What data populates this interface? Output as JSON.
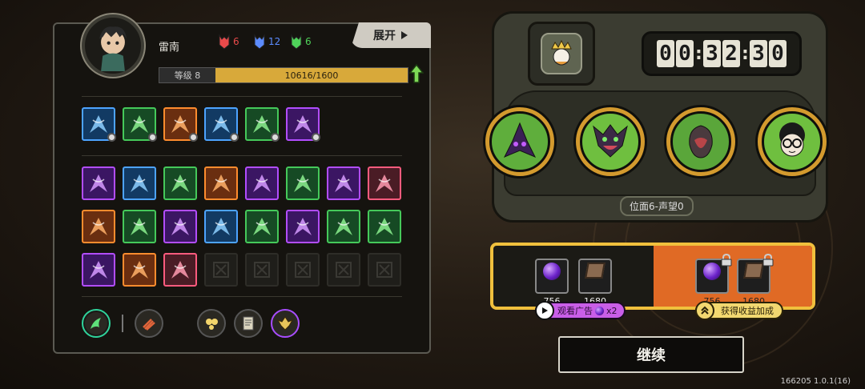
{
  "player": {
    "name": "雷南",
    "resources": [
      {
        "icon": "red-mask-icon",
        "value": "6",
        "color": "#e84a4a"
      },
      {
        "icon": "blue-mask-icon",
        "value": "12",
        "color": "#5c8cff"
      },
      {
        "icon": "green-mask-icon",
        "value": "6",
        "color": "#4fd35a"
      }
    ],
    "level_label": "等级 8",
    "exp_text": "10616/1600",
    "exp_progress": 1.0
  },
  "expand_label": "展开",
  "equipped_skills": [
    {
      "icon": "spear-burst-icon",
      "color": "blue",
      "badge": true
    },
    {
      "icon": "shield-swirl-icon",
      "color": "green",
      "badge": true
    },
    {
      "icon": "fist-strike-icon",
      "color": "orange",
      "badge": true
    },
    {
      "icon": "orb-spiral-icon",
      "color": "blue",
      "badge": true
    },
    {
      "icon": "green-spikes-icon",
      "color": "green",
      "badge": true
    },
    {
      "icon": "shadow-figure-icon",
      "color": "purple",
      "badge": true
    }
  ],
  "skill_grid": [
    [
      {
        "icon": "purple-dragon-icon",
        "color": "purple"
      },
      {
        "icon": "ice-serpent-icon",
        "color": "blue"
      },
      {
        "icon": "wind-slash-icon",
        "color": "green"
      },
      {
        "icon": "split-blades-icon",
        "color": "orange"
      },
      {
        "icon": "vortex-icon",
        "color": "purple"
      },
      {
        "icon": "cyclone-icon",
        "color": "green"
      },
      {
        "icon": "golden-ring-icon",
        "color": "purple"
      },
      {
        "icon": "reed-blades-icon",
        "color": "pink"
      }
    ],
    [
      {
        "icon": "fire-beast-icon",
        "color": "orange"
      },
      {
        "icon": "red-arrow-icon",
        "color": "green"
      },
      {
        "icon": "pink-feather-icon",
        "color": "purple"
      },
      {
        "icon": "blue-shards-icon",
        "color": "blue"
      },
      {
        "icon": "green-lightning-icon",
        "color": "green"
      },
      {
        "icon": "crescent-moon-icon",
        "color": "purple"
      },
      {
        "icon": "v-wings-icon",
        "color": "green"
      },
      {
        "icon": "radiant-sigil-icon",
        "color": "green"
      }
    ],
    [
      {
        "icon": "thorn-armor-icon",
        "color": "purple"
      },
      {
        "icon": "dash-figure-icon",
        "color": "orange"
      },
      {
        "icon": "rose-beast-icon",
        "color": "pink"
      },
      {
        "icon": "empty-slot-icon",
        "color": "empty"
      },
      {
        "icon": "empty-slot-icon",
        "color": "empty"
      },
      {
        "icon": "empty-slot-icon",
        "color": "empty"
      },
      {
        "icon": "empty-slot-icon",
        "color": "empty"
      },
      {
        "icon": "empty-slot-icon",
        "color": "empty"
      }
    ]
  ],
  "bottom_icons": [
    {
      "icon": "green-wing-icon",
      "style": "teal"
    },
    {
      "icon": "claw-talisman-icon",
      "style": "plain"
    },
    {
      "icon": "gold-orbs-icon",
      "style": "plain"
    },
    {
      "icon": "scroll-icon",
      "style": "plain"
    },
    {
      "icon": "winged-helm-icon",
      "style": "purple"
    }
  ],
  "timer": {
    "digits": [
      "0",
      "0",
      "3",
      "2",
      "3",
      "0"
    ]
  },
  "boss_icon": "crowned-king-icon",
  "enemies": [
    {
      "icon": "purple-crystal-wraith-icon",
      "bg": "#5fae3c"
    },
    {
      "icon": "horned-demon-icon",
      "bg": "#6fbf3f"
    },
    {
      "icon": "hooded-beast-icon",
      "bg": "#5aa63a"
    },
    {
      "icon": "curly-hair-glasses-icon",
      "bg": "#6fbf3f"
    }
  ],
  "position_label": "位面6-声望0",
  "rewards": {
    "base": [
      {
        "icon": "purple-gem-icon",
        "value": "756"
      },
      {
        "icon": "book-icon",
        "value": "1680"
      }
    ],
    "bonus": [
      {
        "icon": "purple-gem-icon",
        "value": "756",
        "locked": true
      },
      {
        "icon": "book-icon",
        "value": "1680",
        "locked": true
      }
    ],
    "ad_label": "观看广告",
    "ad_multiplier": "x2",
    "boost_label": "获得收益加成"
  },
  "continue_label": "继续",
  "version": "166205 1.0.1(16)"
}
